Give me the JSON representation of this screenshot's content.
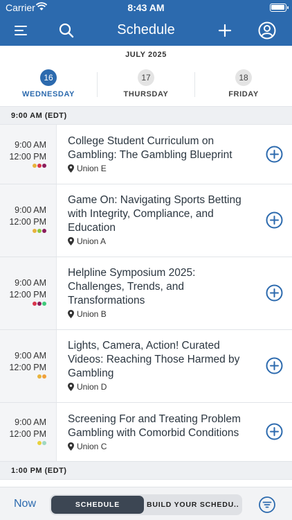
{
  "status_bar": {
    "carrier": "Carrier",
    "time": "8:43 AM"
  },
  "nav": {
    "title": "Schedule",
    "menu_icon": "menu-icon",
    "search_icon": "search-icon",
    "add_icon": "plus-icon",
    "profile_icon": "profile-icon"
  },
  "date_header": {
    "month": "JULY 2025",
    "days": [
      {
        "num": "16",
        "name": "WEDNESDAY",
        "active": true
      },
      {
        "num": "17",
        "name": "THURSDAY",
        "active": false
      },
      {
        "num": "18",
        "name": "FRIDAY",
        "active": false
      }
    ]
  },
  "sections": [
    {
      "header": "9:00 AM (EDT)"
    },
    {
      "header": "1:00 PM (EDT)"
    }
  ],
  "sessions": [
    {
      "start": "9:00 AM",
      "end": "12:00 PM",
      "title": "College Student Curriculum on Gambling: The Gambling Blueprint",
      "location": "Union E",
      "dot_colors": [
        "#e8b33c",
        "#d8354c",
        "#8c1d5c"
      ]
    },
    {
      "start": "9:00 AM",
      "end": "12:00 PM",
      "title": "Game On: Navigating Sports Betting with Integrity, Compliance, and Education",
      "location": "Union A",
      "dot_colors": [
        "#e8b33c",
        "#8cc63f",
        "#8c1d5c"
      ]
    },
    {
      "start": "9:00 AM",
      "end": "12:00 PM",
      "title": "Helpline Symposium 2025: Challenges, Trends, and Transformations",
      "location": "Union B",
      "dot_colors": [
        "#d8354c",
        "#8c1d5c",
        "#3fc97a"
      ]
    },
    {
      "start": "9:00 AM",
      "end": "12:00 PM",
      "title": "Lights, Camera, Action! Curated Videos: Reaching Those Harmed by Gambling",
      "location": "Union D",
      "dot_colors": [
        "#e8b33c",
        "#f0a13b"
      ]
    },
    {
      "start": "9:00 AM",
      "end": "12:00 PM",
      "title": "Screening For and Treating Problem Gambling with Comorbid Conditions",
      "location": "Union C",
      "dot_colors": [
        "#e8d13c",
        "#9fd8c2"
      ]
    }
  ],
  "tab_bar": {
    "now": "Now",
    "schedule": "SCHEDULE",
    "build": "BUILD YOUR SCHEDU...",
    "filter_icon": "filter-icon"
  },
  "colors": {
    "brand": "#2c6aae",
    "add_icon": "#2c6aae"
  }
}
